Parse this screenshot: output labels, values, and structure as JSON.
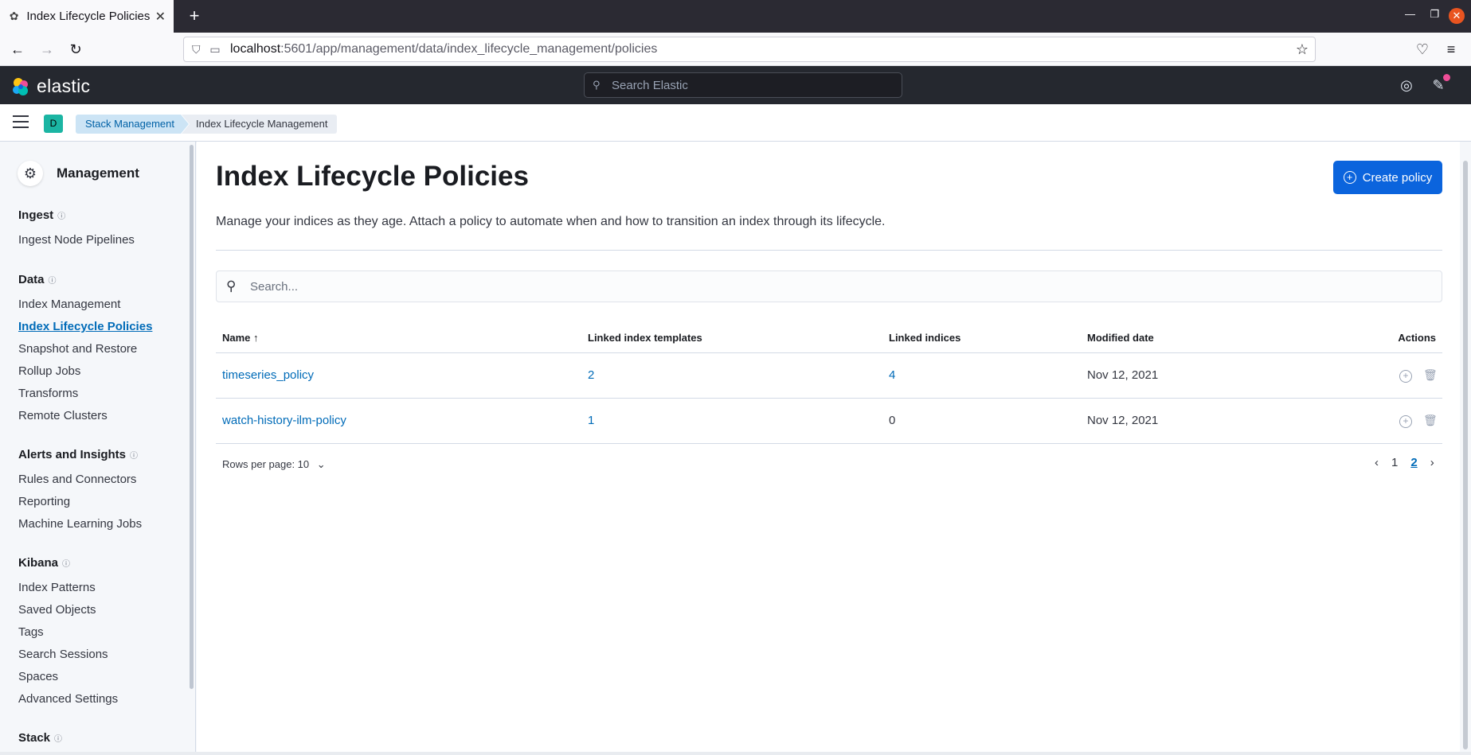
{
  "browser": {
    "tab_title": "Index Lifecycle Policies - ",
    "url_host": "localhost",
    "url_path": ":5601/app/management/data/index_lifecycle_management/policies"
  },
  "header": {
    "brand": "elastic",
    "search_placeholder": "Search Elastic",
    "space_initial": "D",
    "breadcrumbs": [
      "Stack Management",
      "Index Lifecycle Management"
    ]
  },
  "sidebar": {
    "title": "Management",
    "sections": [
      {
        "label": "Ingest",
        "items": [
          "Ingest Node Pipelines"
        ]
      },
      {
        "label": "Data",
        "items": [
          "Index Management",
          "Index Lifecycle Policies",
          "Snapshot and Restore",
          "Rollup Jobs",
          "Transforms",
          "Remote Clusters"
        ]
      },
      {
        "label": "Alerts and Insights",
        "items": [
          "Rules and Connectors",
          "Reporting",
          "Machine Learning Jobs"
        ]
      },
      {
        "label": "Kibana",
        "items": [
          "Index Patterns",
          "Saved Objects",
          "Tags",
          "Search Sessions",
          "Spaces",
          "Advanced Settings"
        ]
      },
      {
        "label": "Stack",
        "items": []
      }
    ],
    "active_item": "Index Lifecycle Policies"
  },
  "page": {
    "title": "Index Lifecycle Policies",
    "create_button": "Create policy",
    "description": "Manage your indices as they age. Attach a policy to automate when and how to transition an index through its lifecycle.",
    "search_placeholder": "Search..."
  },
  "table": {
    "columns": [
      "Name",
      "Linked index templates",
      "Linked indices",
      "Modified date",
      "Actions"
    ],
    "rows": [
      {
        "name": "timeseries_policy",
        "templates": "2",
        "indices": "4",
        "modified": "Nov 12, 2021"
      },
      {
        "name": "watch-history-ilm-policy",
        "templates": "1",
        "indices": "0",
        "modified": "Nov 12, 2021"
      }
    ]
  },
  "pagination": {
    "rows_per_page": "Rows per page: 10",
    "pages": [
      "1",
      "2"
    ],
    "current": "2"
  },
  "colors": {
    "primary": "#0b64dd",
    "link": "#006bb8",
    "header_bg": "#25282f",
    "space_badge": "#1bb5a3"
  }
}
